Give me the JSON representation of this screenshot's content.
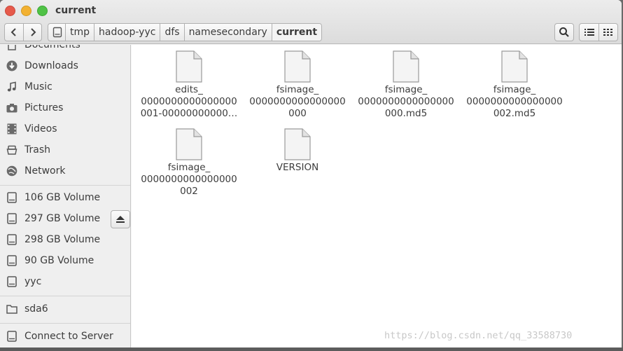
{
  "window": {
    "title": "current"
  },
  "breadcrumb": [
    "tmp",
    "hadoop-yyc",
    "dfs",
    "namesecondary",
    "current"
  ],
  "sidebar": {
    "places": [
      {
        "label": "Documents",
        "icon": "documents-icon"
      },
      {
        "label": "Downloads",
        "icon": "download-icon"
      },
      {
        "label": "Music",
        "icon": "music-icon"
      },
      {
        "label": "Pictures",
        "icon": "camera-icon"
      },
      {
        "label": "Videos",
        "icon": "film-icon"
      },
      {
        "label": "Trash",
        "icon": "trash-icon"
      },
      {
        "label": "Network",
        "icon": "network-icon"
      }
    ],
    "devices": [
      {
        "label": "106 GB Volume",
        "icon": "drive-icon"
      },
      {
        "label": "297 GB Volume",
        "icon": "drive-icon"
      },
      {
        "label": "298 GB Volume",
        "icon": "drive-icon"
      },
      {
        "label": "90 GB Volume",
        "icon": "drive-icon"
      },
      {
        "label": "yyc",
        "icon": "drive-icon"
      }
    ],
    "other": [
      {
        "label": "sda6",
        "icon": "folder-icon"
      },
      {
        "label": "Connect to Server",
        "icon": "server-icon"
      }
    ]
  },
  "files": [
    {
      "name": "edits_\n0000000000000000\n001-00000000000…"
    },
    {
      "name": "fsimage_\n0000000000000000\n000"
    },
    {
      "name": "fsimage_\n0000000000000000\n000.md5"
    },
    {
      "name": "fsimage_\n0000000000000000\n002.md5"
    },
    {
      "name": "fsimage_\n0000000000000000\n002"
    },
    {
      "name": "VERSION"
    }
  ],
  "watermark": "https://blog.csdn.net/qq_33588730"
}
